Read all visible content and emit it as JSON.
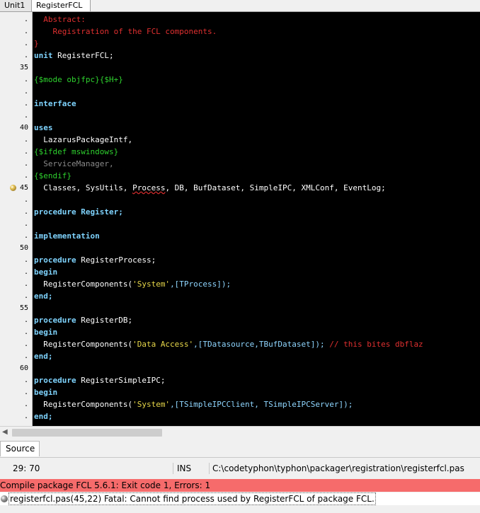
{
  "tabs": [
    {
      "label": "Unit1",
      "active": false
    },
    {
      "label": "RegisterFCL",
      "active": true
    }
  ],
  "code_lines": [
    {
      "num": ".",
      "tokens": [
        [
          "  Abstract:",
          "cmt"
        ]
      ]
    },
    {
      "num": ".",
      "tokens": [
        [
          "    Registration of the FCL components.",
          "cmt"
        ]
      ]
    },
    {
      "num": ".",
      "tokens": [
        [
          "}",
          "cmt"
        ]
      ]
    },
    {
      "num": ".",
      "tokens": [
        [
          "unit",
          "kw"
        ],
        [
          " RegisterFCL;",
          ""
        ]
      ]
    },
    {
      "num": "35",
      "tokens": []
    },
    {
      "num": ".",
      "tokens": [
        [
          "{$mode objfpc}{$H+}",
          "dir"
        ]
      ]
    },
    {
      "num": ".",
      "tokens": []
    },
    {
      "num": ".",
      "tokens": [
        [
          "interface",
          "kw"
        ]
      ]
    },
    {
      "num": ".",
      "tokens": []
    },
    {
      "num": "40",
      "tokens": [
        [
          "uses",
          "kw"
        ]
      ]
    },
    {
      "num": ".",
      "tokens": [
        [
          "  LazarusPackageIntf,",
          ""
        ]
      ]
    },
    {
      "num": ".",
      "tokens": [
        [
          "{$ifdef mswindows}",
          "dir"
        ]
      ]
    },
    {
      "num": ".",
      "tokens": [
        [
          "  ServiceManager,",
          "dim"
        ]
      ]
    },
    {
      "num": ".",
      "tokens": [
        [
          "{$endif}",
          "dir"
        ]
      ]
    },
    {
      "num": "45",
      "marker": true,
      "tokens": [
        [
          "  Classes, SysUtils, ",
          ""
        ],
        [
          "Process",
          "err"
        ],
        [
          ", DB, BufDataset, SimpleIPC, XMLConf, EventLog;",
          ""
        ]
      ]
    },
    {
      "num": ".",
      "tokens": []
    },
    {
      "num": ".",
      "tokens": [
        [
          "procedure",
          "kw"
        ],
        [
          " Register;",
          "kw"
        ]
      ]
    },
    {
      "num": ".",
      "tokens": []
    },
    {
      "num": ".",
      "tokens": [
        [
          "implementation",
          "kw"
        ]
      ]
    },
    {
      "num": "50",
      "tokens": []
    },
    {
      "num": ".",
      "tokens": [
        [
          "procedure",
          "kw"
        ],
        [
          " RegisterProcess;",
          ""
        ]
      ]
    },
    {
      "num": ".",
      "tokens": [
        [
          "begin",
          "kw"
        ]
      ]
    },
    {
      "num": ".",
      "tokens": [
        [
          "  RegisterComponents(",
          ""
        ],
        [
          "'System'",
          "str"
        ],
        [
          ",[TProcess]);",
          "sym"
        ]
      ]
    },
    {
      "num": ".",
      "tokens": [
        [
          "end;",
          "kw"
        ]
      ]
    },
    {
      "num": "55",
      "tokens": []
    },
    {
      "num": ".",
      "tokens": [
        [
          "procedure",
          "kw"
        ],
        [
          " RegisterDB;",
          ""
        ]
      ]
    },
    {
      "num": ".",
      "tokens": [
        [
          "begin",
          "kw"
        ]
      ]
    },
    {
      "num": ".",
      "tokens": [
        [
          "  RegisterComponents(",
          ""
        ],
        [
          "'Data Access'",
          "str"
        ],
        [
          ",[TDatasource,TBufDataset]);",
          "sym"
        ],
        [
          " // this bites dbflaz",
          "cmt"
        ]
      ]
    },
    {
      "num": ".",
      "tokens": [
        [
          "end;",
          "kw"
        ]
      ]
    },
    {
      "num": "60",
      "tokens": []
    },
    {
      "num": ".",
      "tokens": [
        [
          "procedure",
          "kw"
        ],
        [
          " RegisterSimpleIPC;",
          ""
        ]
      ]
    },
    {
      "num": ".",
      "tokens": [
        [
          "begin",
          "kw"
        ]
      ]
    },
    {
      "num": ".",
      "tokens": [
        [
          "  RegisterComponents(",
          ""
        ],
        [
          "'System'",
          "str"
        ],
        [
          ",[TSimpleIPCClient, TSimpleIPCServer]);",
          "sym"
        ]
      ]
    },
    {
      "num": ".",
      "tokens": [
        [
          "end;",
          "kw"
        ]
      ]
    }
  ],
  "source_tab": {
    "label": "Source"
  },
  "status": {
    "position": "29:  70",
    "mode": "INS",
    "path": "C:\\codetyphon\\typhon\\packager\\registration\\registerfcl.pas"
  },
  "messages": {
    "error": "Compile package FCL 5.6.1: Exit code 1, Errors: 1",
    "fatal": "registerfcl.pas(45,22) Fatal: Cannot find process used by RegisterFCL of package FCL."
  },
  "icons": {
    "line_marker": "bookmark-icon",
    "fatal_marker": "error-icon",
    "scroll_left": "chevron-left-icon"
  },
  "colors": {
    "editor_bg": "#000000",
    "keyword": "#7fd4ff",
    "comment": "#e03030",
    "directive": "#2ed12e",
    "string": "#e8d84a",
    "error_bar": "#f66b6b"
  }
}
